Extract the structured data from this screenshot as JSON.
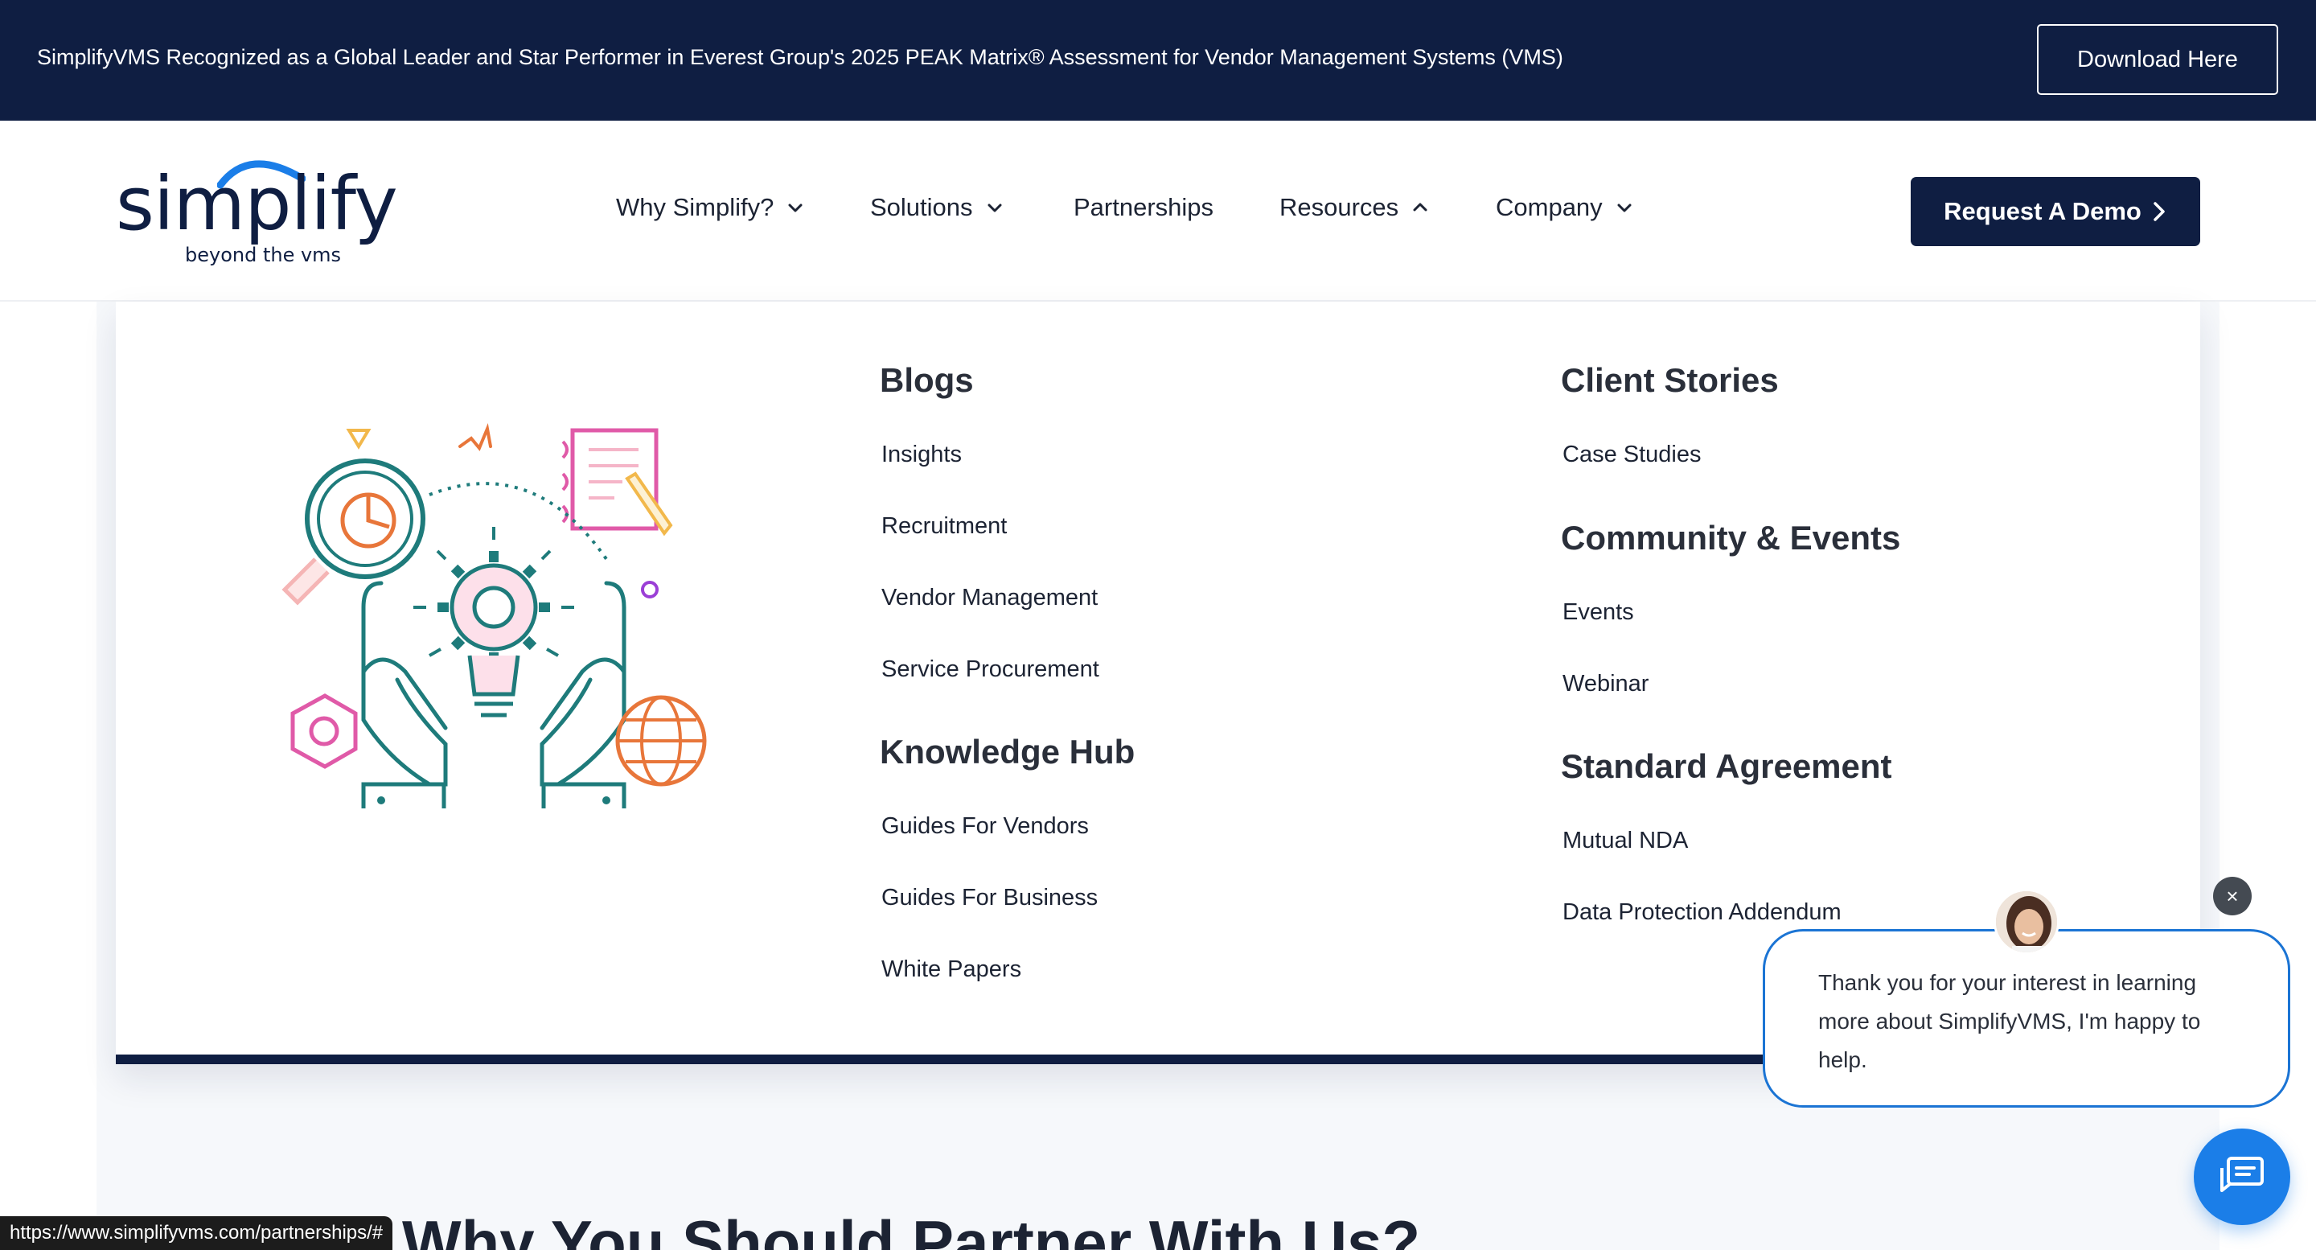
{
  "announcement": {
    "text": "SimplifyVMS Recognized as a Global Leader and Star Performer in Everest Group's 2025 PEAK Matrix® Assessment for Vendor Management Systems (VMS)",
    "button": "Download Here"
  },
  "logo": {
    "word": "simplify",
    "tagline": "beyond the vms"
  },
  "nav": {
    "items": [
      {
        "label": "Why Simplify?",
        "chevron": "chevron-down-icon"
      },
      {
        "label": "Solutions",
        "chevron": "chevron-down-icon"
      },
      {
        "label": "Partnerships"
      },
      {
        "label": "Resources",
        "chevron": "chevron-up-icon"
      },
      {
        "label": "Company",
        "chevron": "chevron-down-icon"
      }
    ],
    "cta": "Request A Demo"
  },
  "menu": {
    "blogs": {
      "heading": "Blogs",
      "links": [
        "Insights",
        "Recruitment",
        "Vendor Management",
        "Service Procurement"
      ]
    },
    "knowledge": {
      "heading": "Knowledge Hub",
      "links": [
        "Guides For Vendors",
        "Guides For Business",
        "White Papers"
      ]
    },
    "client": {
      "heading": "Client Stories",
      "links": [
        "Case Studies"
      ]
    },
    "community": {
      "heading": "Community & Events",
      "links": [
        "Events",
        "Webinar"
      ]
    },
    "standard": {
      "heading": "Standard Agreement",
      "links": [
        "Mutual NDA",
        "Data Protection Addendum"
      ]
    }
  },
  "page": {
    "partner_heading": "Why You Should Partner With Us?"
  },
  "status_url": "https://www.simplifyvms.com/partnerships/#",
  "chat": {
    "message": "Thank you for your interest in learning more about SimplifyVMS, I'm happy to help.",
    "close": "×"
  },
  "colors": {
    "navy": "#0f1e42",
    "accent_blue": "#1b74d4",
    "teal": "#1e7b7b",
    "orange": "#e8763a",
    "pink": "#e05aa8"
  }
}
